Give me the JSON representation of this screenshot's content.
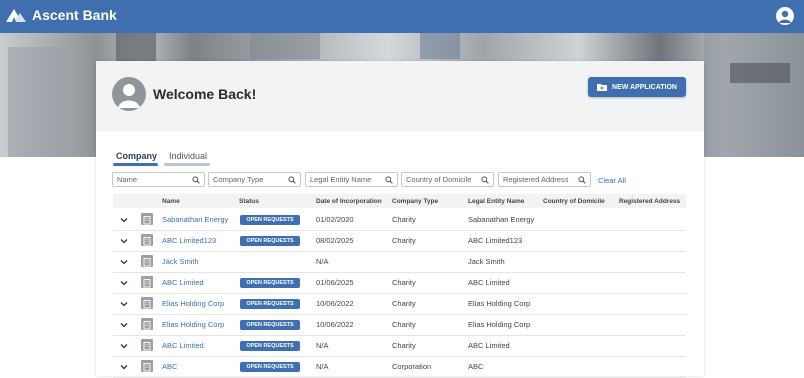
{
  "app": {
    "brand": "Ascent Bank"
  },
  "header": {
    "welcome": "Welcome Back!",
    "new_application": "NEW APPLICATION"
  },
  "tabs": [
    {
      "label": "Company",
      "active": true
    },
    {
      "label": "Individual",
      "active": false
    }
  ],
  "filters": {
    "name": "Name",
    "company_type": "Company Type",
    "legal_entity_name": "Legal Entity Name",
    "country_of_domicile": "Country of Domicile",
    "registered_address": "Registered Address",
    "clear_all": "Clear All"
  },
  "table": {
    "columns": [
      "Name",
      "Status",
      "Date of Incorporation",
      "Company Type",
      "Legal Entity Name",
      "Country of Domicile",
      "Registered Address"
    ],
    "rows": [
      {
        "name": "Sabanathan Energy",
        "status": "OPEN REQUESTS",
        "date": "01/02/2020",
        "type": "Charity",
        "legal": "Sabanathan Energy",
        "country": "",
        "address": ""
      },
      {
        "name": "ABC Limited123",
        "status": "OPEN REQUESTS",
        "date": "08/02/2025",
        "type": "Charity",
        "legal": "ABC Limited123",
        "country": "",
        "address": ""
      },
      {
        "name": "Jack Smith",
        "status": "",
        "date": "N/A",
        "type": "",
        "legal": "Jack Smith",
        "country": "",
        "address": ""
      },
      {
        "name": "ABC Limited",
        "status": "OPEN REQUESTS",
        "date": "01/06/2025",
        "type": "Charity",
        "legal": "ABC Limited",
        "country": "",
        "address": ""
      },
      {
        "name": "Elias Holding Corp",
        "status": "OPEN REQUESTS",
        "date": "10/06/2022",
        "type": "Charity",
        "legal": "Elias Holding Corp",
        "country": "",
        "address": ""
      },
      {
        "name": "Elias Holding Corp",
        "status": "OPEN REQUESTS",
        "date": "10/06/2022",
        "type": "Charity",
        "legal": "Elias Holding Corp",
        "country": "",
        "address": ""
      },
      {
        "name": "ABC Limited",
        "status": "OPEN REQUESTS",
        "date": "N/A",
        "type": "Charity",
        "legal": "ABC Limited",
        "country": "",
        "address": ""
      },
      {
        "name": "ABC",
        "status": "OPEN REQUESTS",
        "date": "N/A",
        "type": "Corporation",
        "legal": "ABC",
        "country": "",
        "address": ""
      }
    ]
  },
  "colors": {
    "primary": "#3f6fae",
    "header_bg": "#f2f3f5",
    "tab_inactive": "#b9c6da"
  },
  "icons": {
    "brand": "mountain-logo-icon",
    "user": "user-account-icon",
    "avatar": "person-avatar-icon",
    "new": "folder-plus-icon",
    "search": "search-icon",
    "expand": "chevron-down-icon",
    "entity": "building-icon"
  }
}
